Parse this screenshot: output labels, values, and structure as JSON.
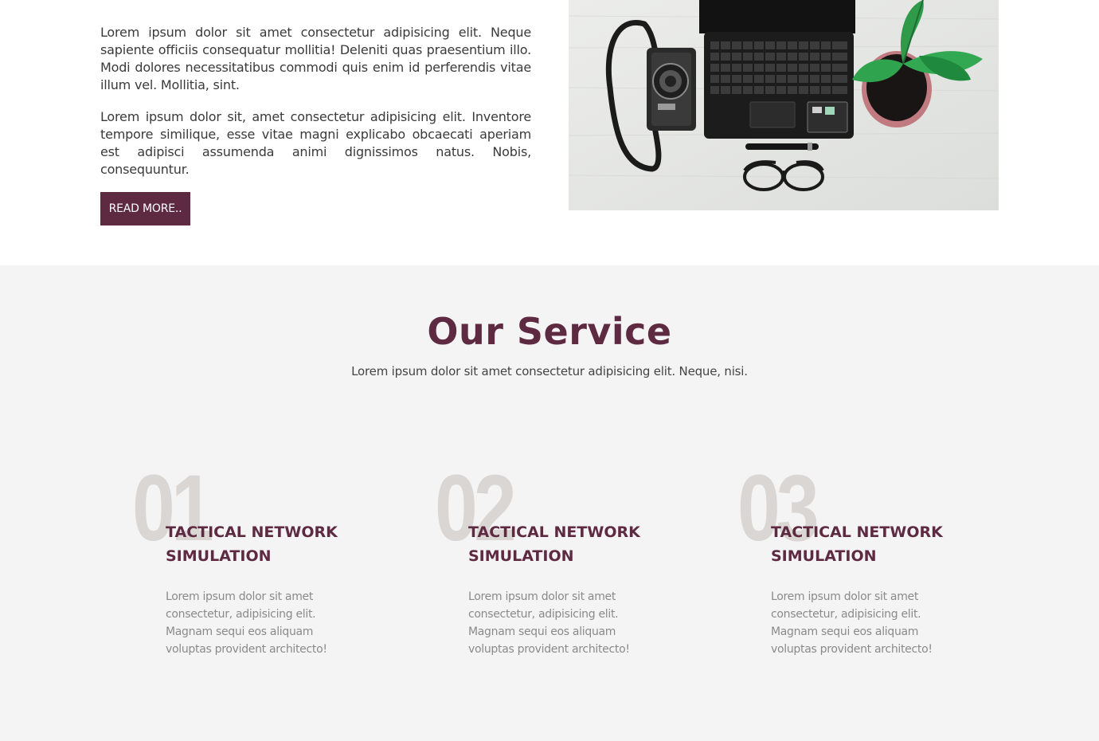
{
  "about": {
    "paragraphs": [
      "Lorem ipsum dolor sit amet consectetur adipisicing elit. Neque sapiente officiis consequatur mollitia! Deleniti quas praesentium illo. Modi dolores necessitatibus commodi quis enim id perferendis vitae illum vel. Mollitia, sint.",
      "Lorem ipsum dolor sit, amet consectetur adipisicing elit. Inventore tempore similique, esse vitae magni explicabo obcaecati aperiam est adipisci assumenda animi dignissimos natus. Nobis, consequuntur."
    ],
    "read_more_label": "READ MORE.."
  },
  "service": {
    "title": "Our Service",
    "subtitle": "Lorem ipsum dolor sit amet consectetur adipisicing elit. Neque, nisi.",
    "cards": [
      {
        "number": "01",
        "title": "TACTICAL NETWORK SIMULATION",
        "description": "Lorem ipsum dolor sit amet consectetur, adipisicing elit. Magnam sequi eos aliquam voluptas provident architecto!"
      },
      {
        "number": "02",
        "title": "TACTICAL NETWORK SIMULATION",
        "description": "Lorem ipsum dolor sit amet consectetur, adipisicing elit. Magnam sequi eos aliquam voluptas provident architecto!"
      },
      {
        "number": "03",
        "title": "TACTICAL NETWORK SIMULATION",
        "description": "Lorem ipsum dolor sit amet consectetur, adipisicing elit. Magnam sequi eos aliquam voluptas provident architecto!"
      }
    ]
  },
  "colors": {
    "accent": "#5e2a42",
    "number_gray": "#d9d6d3",
    "section_bg": "#f4f4f4"
  }
}
